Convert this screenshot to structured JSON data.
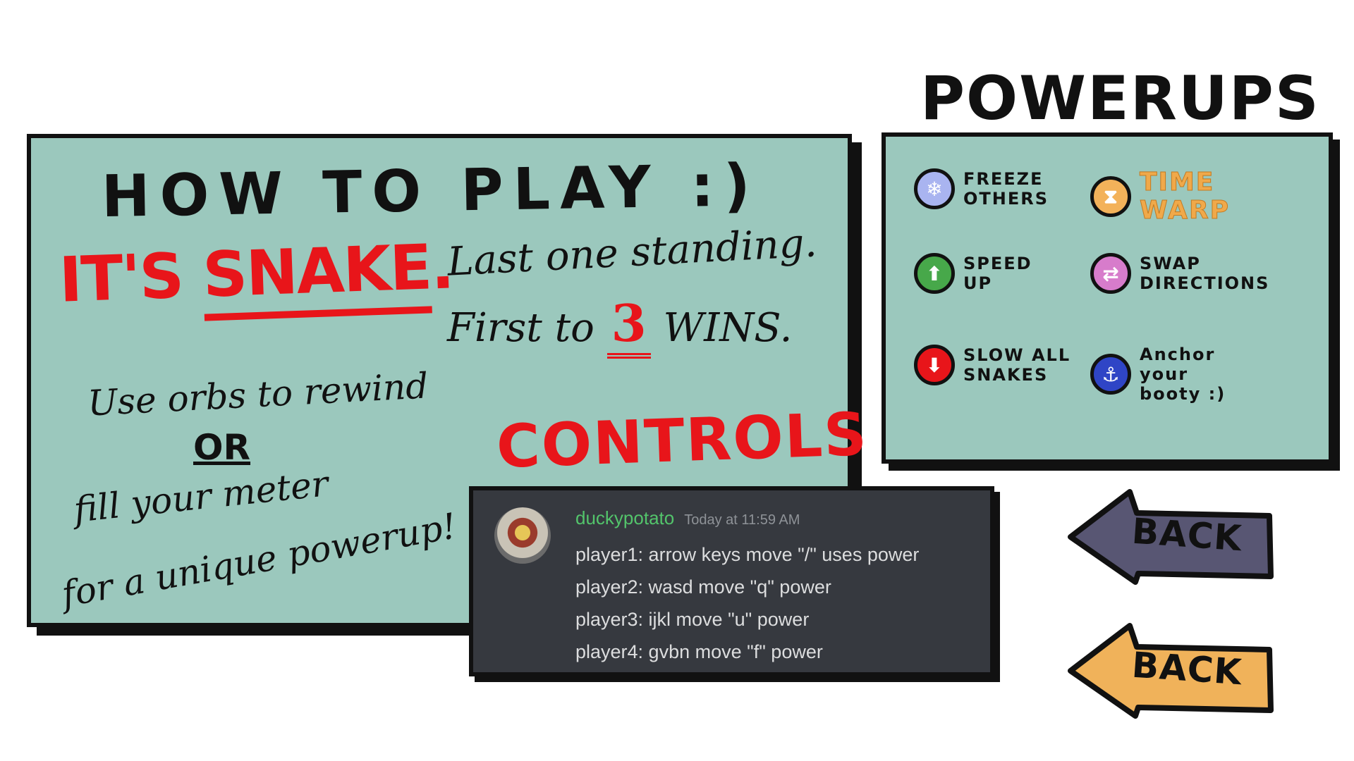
{
  "howto": {
    "title": "HOW TO PLAY :)",
    "snake_prefix": "IT'S ",
    "snake_word": "SNAKE",
    "snake_suffix": ".",
    "rule1": "Last one standing.",
    "rule2_prefix": "First to ",
    "rule2_number": "3",
    "rule2_suffix": " WINS.",
    "tip1": "Use orbs to rewind",
    "tip_or": "OR",
    "tip2": "fill your meter",
    "tip3": "for a unique powerup!",
    "controls_title": "CONTROLS"
  },
  "chat": {
    "username": "duckypotato",
    "timestamp": "Today at 11:59 AM",
    "lines": [
      "player1: arrow keys move \"/\" uses power",
      "player2: wasd move \"q\" power",
      "player3: ijkl move \"u\" power",
      "player4: gvbn move \"f\" power"
    ]
  },
  "powerups": {
    "title": "POWERUPS",
    "items": [
      {
        "label": "FREEZE OTHERS",
        "icon": "snowflake-icon",
        "color": "#a9b4f0",
        "glyph": "❄"
      },
      {
        "label": "TIME WARP",
        "icon": "hourglass-icon",
        "color": "#f3b25a",
        "glyph": "⧗"
      },
      {
        "label": "SPEED UP",
        "icon": "up-arrow-icon",
        "color": "#47a84a",
        "glyph": "⬆"
      },
      {
        "label": "SWAP DIRECTIONS",
        "icon": "swap-icon",
        "color": "#d77ccb",
        "glyph": "⇄"
      },
      {
        "label": "SLOW ALL SNAKES",
        "icon": "down-arrow-icon",
        "color": "#e8151a",
        "glyph": "⬇"
      },
      {
        "label": "Anchor your booty :)",
        "icon": "anchor-icon",
        "color": "#2f45c6",
        "glyph": "⚓"
      }
    ]
  },
  "buttons": {
    "back1_label": "BACK",
    "back1_color": "#585673",
    "back2_label": "BACK",
    "back2_color": "#f0b25a"
  }
}
